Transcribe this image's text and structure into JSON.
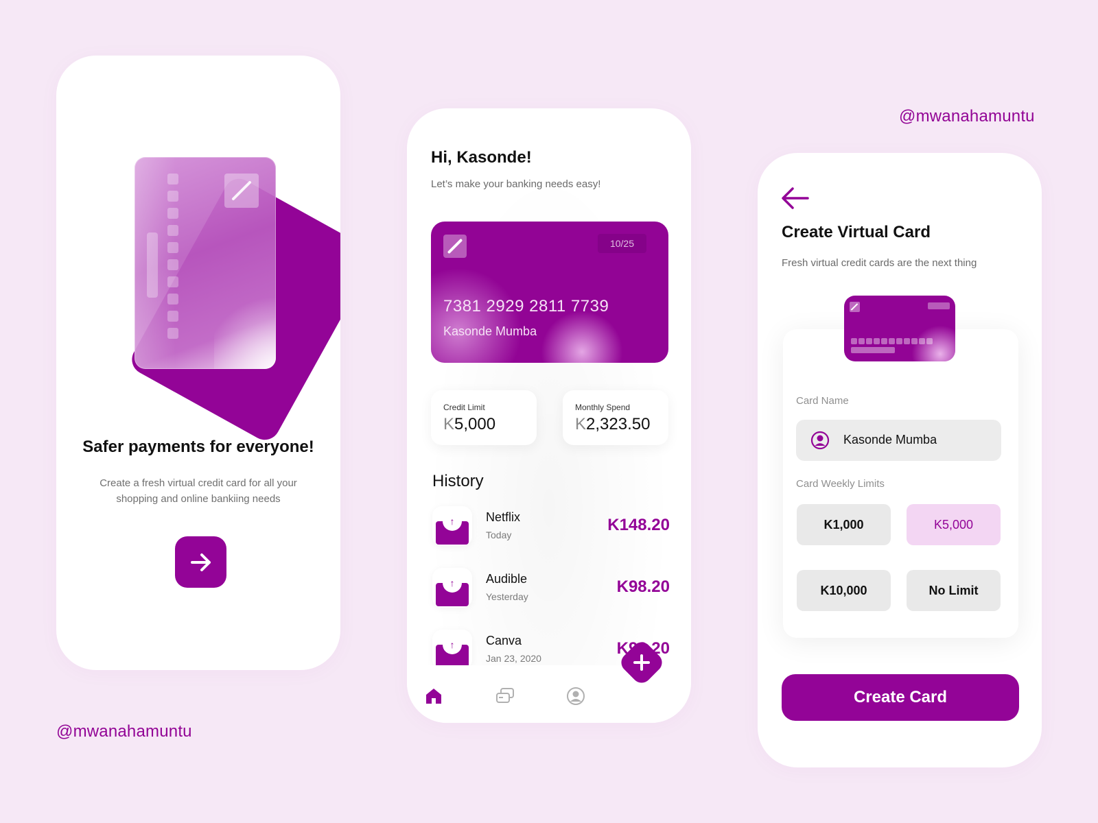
{
  "handles": {
    "top_right": "@mwanahamuntu",
    "bottom_left": "@mwanahamuntu"
  },
  "colors": {
    "background": "#F6E8F6",
    "accent": "#930497",
    "selected_option_bg": "#F3D6F3"
  },
  "onboarding": {
    "title": "Safer payments for everyone!",
    "subtitle": "Create a fresh virtual credit card for all your shopping and online bankiing needs",
    "next_icon": "arrow-right-icon"
  },
  "home": {
    "greeting": "Hi, Kasonde!",
    "greeting_sub": "Let’s make your banking needs easy!",
    "card": {
      "expiry": "10/25",
      "number": "7381 2929 2811 7739",
      "holder": "Kasonde Mumba"
    },
    "credit_limit": {
      "label": "Credit Limit",
      "currency": "K",
      "amount": "5,000"
    },
    "monthly_spend": {
      "label": "Monthly Spend",
      "currency": "K",
      "amount": "2,323.50"
    },
    "history_title": "History",
    "history": [
      {
        "name": "Netflix",
        "date": "Today",
        "amount": "K148.20"
      },
      {
        "name": "Audible",
        "date": "Yesterday",
        "amount": "K98.20"
      },
      {
        "name": "Canva",
        "date": "Jan 23, 2020",
        "amount": "K98.20"
      }
    ],
    "nav": [
      "home-icon",
      "cards-icon",
      "profile-icon"
    ],
    "fab_icon": "plus-icon"
  },
  "create_card": {
    "back_icon": "arrow-left-icon",
    "title": "Create Virtual Card",
    "subtitle": "Fresh virtual credit cards are the next thing",
    "card_name_label": "Card Name",
    "card_name_value": "Kasonde Mumba",
    "limits_label": "Card Weekly Limits",
    "limits": [
      {
        "label": "K1,000",
        "selected": false
      },
      {
        "label": "K5,000",
        "selected": true
      },
      {
        "label": "K10,000",
        "selected": false
      },
      {
        "label": "No Limit",
        "selected": false
      }
    ],
    "create_button": "Create Card"
  }
}
